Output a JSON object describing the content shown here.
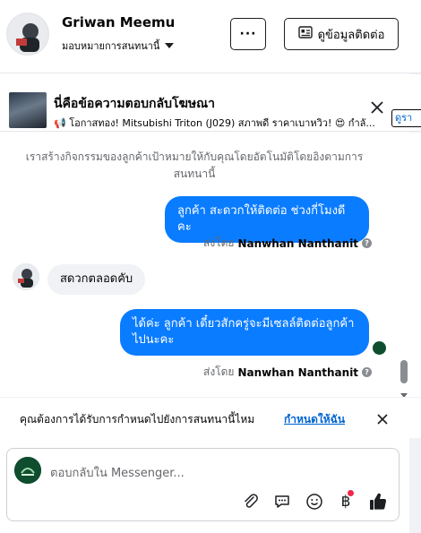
{
  "header": {
    "name": "Griwan Meemu",
    "assign_label": "มอบหมายการสนทนานี้",
    "more_label": "···",
    "contact_label": "ดูข้อมูลติดต่อ"
  },
  "ad": {
    "title": "นี่คือข้อความตอบกลับโฆษณา",
    "snippet": "📢 โอกาสทอง! Mitsubishi Triton (J029) สภาพดี ราคาเบาหวิว! 😍 กำลั...",
    "tag": "ดูรา"
  },
  "chat": {
    "notice": "เราสร้างกิจกรรมของลูกค้าเป้าหมายให้กับคุณโดยอัตโนมัติโดยอิงตามการสนทนานี้",
    "messages": [
      {
        "direction": "out",
        "text": "ลูกค้า สะดวกให้ติดต่อ ช่วงกี่โมงดีคะ"
      },
      {
        "direction": "in",
        "text": "สดวกตลอดคับ"
      },
      {
        "direction": "out",
        "text": "ได้ค่ะ  ลูกค้า  เดี๋ยวสักครู่จะมีเซลล์ติดต่อลูกค้าไปนะคะ"
      }
    ],
    "sent_by_prefix": "ส่งโดย",
    "sent_by_name": "Nanwhan Nanthanit"
  },
  "assign_prompt": {
    "text": "คุณต้องการได้รับการกำหนดไปยังการสนทนานี้ไหม",
    "link": "กำหนดให้ฉัน"
  },
  "composer": {
    "placeholder": "ตอบกลับใน Messenger..."
  },
  "icons": [
    "chevron-down-icon",
    "contact-card-icon",
    "close-icon",
    "info-icon",
    "attachment-icon",
    "saved-reply-icon",
    "emoji-icon",
    "baht-icon",
    "thumbs-up-icon"
  ],
  "colors": {
    "accent": "#0a7cff",
    "link": "#0064d1",
    "incoming_bubble": "#f0f2f5"
  }
}
